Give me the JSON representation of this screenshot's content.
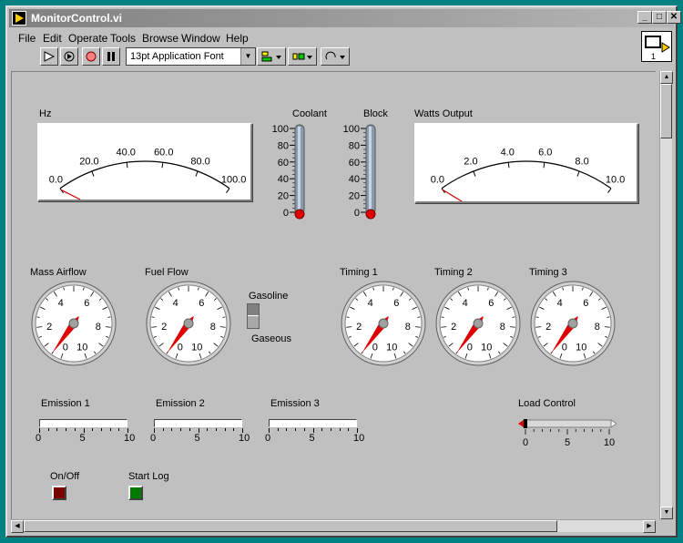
{
  "window": {
    "title": "MonitorControl.vi"
  },
  "menu": [
    "File",
    "Edit",
    "Operate",
    "Tools",
    "Browse",
    "Window",
    "Help"
  ],
  "toolbar": {
    "font": "13pt Application Font"
  },
  "meters": [
    {
      "label": "Hz",
      "ticks": [
        "0.0",
        "20.0",
        "40.0",
        "60.0",
        "80.0",
        "100.0"
      ],
      "value": 0
    },
    {
      "label": "Watts Output",
      "ticks": [
        "0.0",
        "2.0",
        "4.0",
        "6.0",
        "8.0",
        "10.0"
      ],
      "value": 0
    }
  ],
  "thermometers": [
    {
      "label": "Coolant",
      "ticks": [
        "100",
        "80",
        "60",
        "40",
        "20",
        "0"
      ],
      "value": 0
    },
    {
      "label": "Block",
      "ticks": [
        "100",
        "80",
        "60",
        "40",
        "20",
        "0"
      ],
      "value": 0
    }
  ],
  "gauges": [
    {
      "label": "Mass Airflow",
      "ticks": [
        "0",
        "2",
        "4",
        "6",
        "8",
        "10"
      ],
      "value": 0.5
    },
    {
      "label": "Fuel Flow",
      "ticks": [
        "0",
        "2",
        "4",
        "6",
        "8",
        "10"
      ],
      "value": 0.5
    },
    {
      "label": "Timing 1",
      "ticks": [
        "0",
        "2",
        "4",
        "6",
        "8",
        "10"
      ],
      "value": 0.5
    },
    {
      "label": "Timing 2",
      "ticks": [
        "0",
        "2",
        "4",
        "6",
        "8",
        "10"
      ],
      "value": 0.5
    },
    {
      "label": "Timing 3",
      "ticks": [
        "0",
        "2",
        "4",
        "6",
        "8",
        "10"
      ],
      "value": 0.5
    }
  ],
  "fuel_switch": {
    "top": "Gasoline",
    "bottom": "Gaseous"
  },
  "emissions": [
    {
      "label": "Emission 1",
      "ticks": [
        "0",
        "5",
        "10"
      ],
      "value": 0
    },
    {
      "label": "Emission 2",
      "ticks": [
        "0",
        "5",
        "10"
      ],
      "value": 0
    },
    {
      "label": "Emission 3",
      "ticks": [
        "0",
        "5",
        "10"
      ],
      "value": 0
    }
  ],
  "load_control": {
    "label": "Load Control",
    "ticks": [
      "0",
      "5",
      "10"
    ],
    "value": 0
  },
  "buttons": {
    "on_off": {
      "label": "On/Off",
      "color": "#7a0000"
    },
    "start_log": {
      "label": "Start Log",
      "color": "#007a00"
    }
  }
}
